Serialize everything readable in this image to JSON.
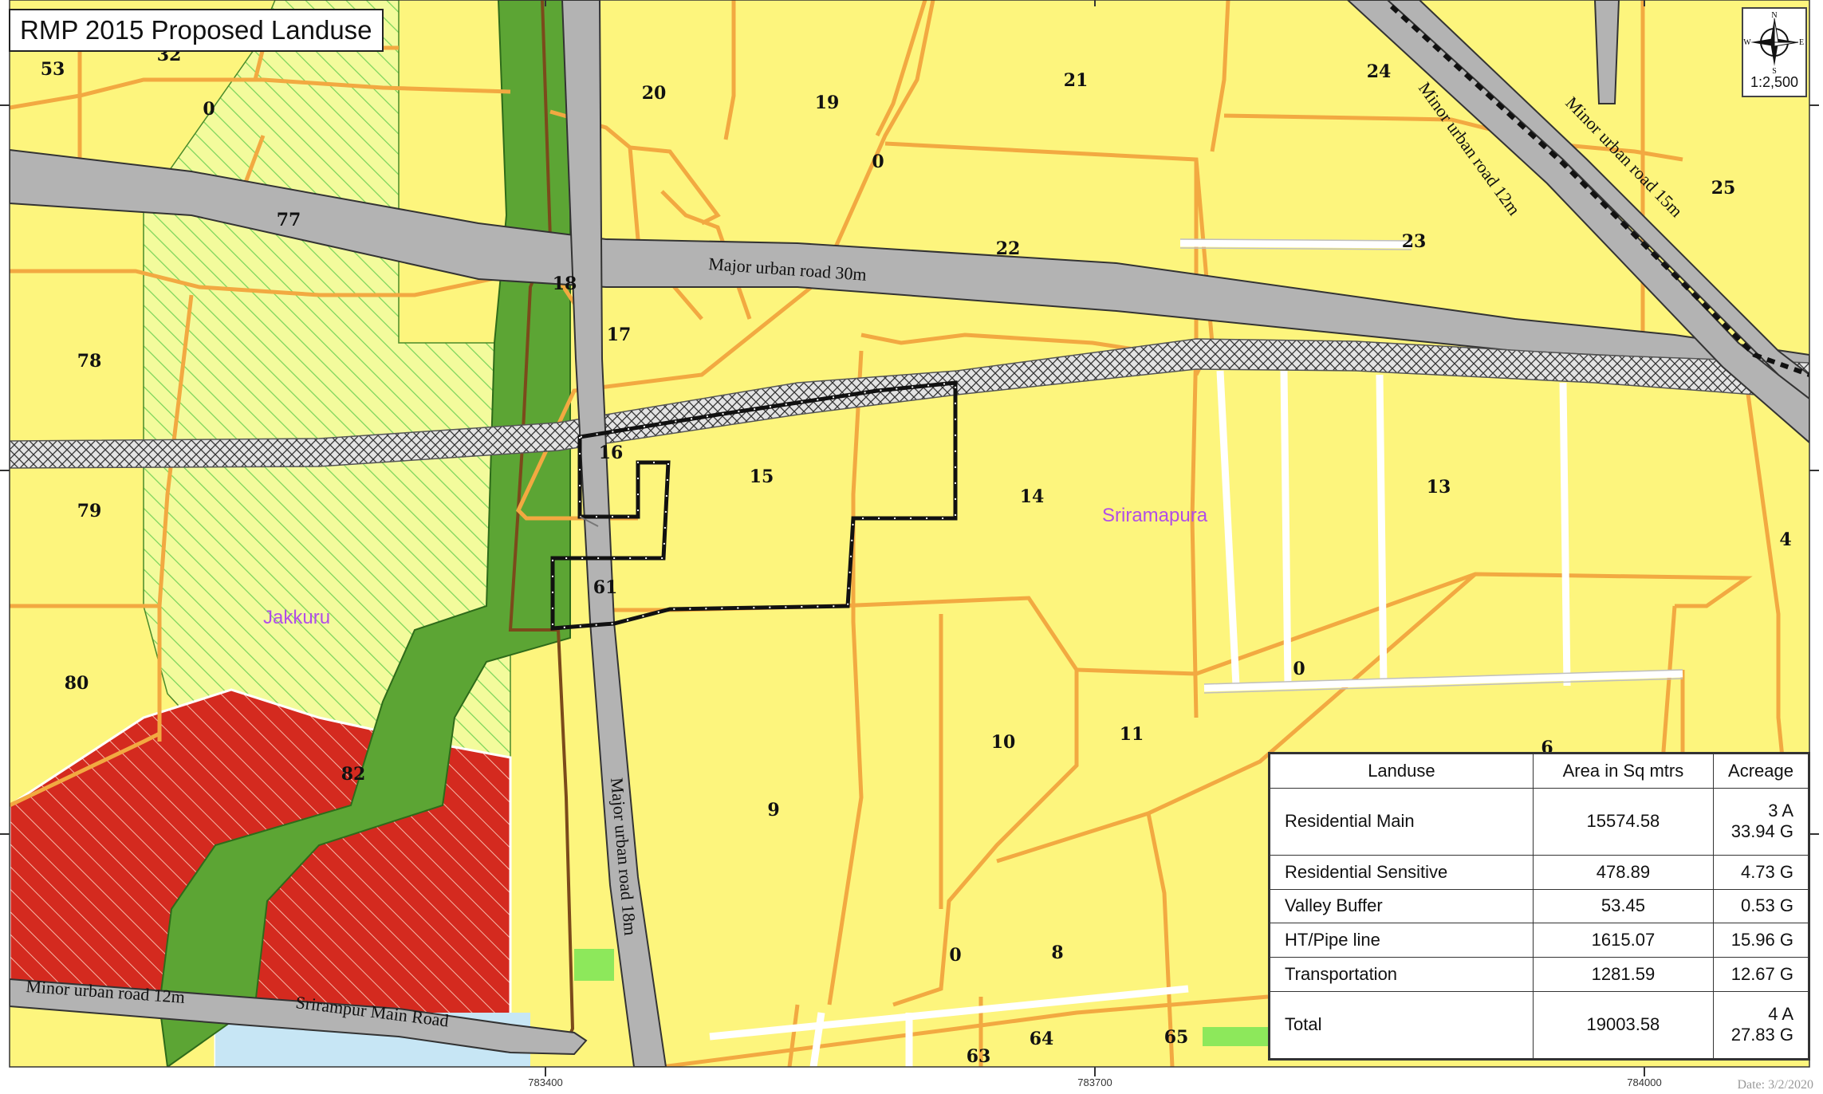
{
  "title": "RMP 2015 Proposed Landuse",
  "scale": "1:2,500",
  "compass": {
    "n": "N",
    "s": "S",
    "e": "E",
    "w": "W"
  },
  "date": "Date: 3/2/2020",
  "colors": {
    "residential": "#fdf57d",
    "road": "#b3b3b3",
    "plot_line": "#f2a941",
    "green": "#5ca534",
    "hatched_green_bg": "#f3fb9c",
    "hatched_green": "#7bd45b",
    "red_zone": "#d42a1f",
    "water": "#c7e6f5",
    "survey_boundary": "#111111",
    "village_label": "#b14ee8"
  },
  "roads": {
    "major_30": "Major urban road 30m",
    "minor_12_ne": "Minor urban road 12m",
    "minor_15_ne": "Minor urban road 15m",
    "major_18": "Major urban road 18m",
    "minor_12_sw": "Minor urban road 12m",
    "srirampur_main": "Srirampur Main Road"
  },
  "villages": {
    "jakkuru": "Jakkuru",
    "sriramapura": "Sriramapura"
  },
  "parcels": [
    {
      "id": "p53",
      "label": "53"
    },
    {
      "id": "p32",
      "label": "32"
    },
    {
      "id": "p0a",
      "label": "0"
    },
    {
      "id": "p20",
      "label": "20"
    },
    {
      "id": "p19",
      "label": "19"
    },
    {
      "id": "p21",
      "label": "21"
    },
    {
      "id": "p24",
      "label": "24"
    },
    {
      "id": "p25",
      "label": "25"
    },
    {
      "id": "p0b",
      "label": "0"
    },
    {
      "id": "p77",
      "label": "77"
    },
    {
      "id": "p22",
      "label": "22"
    },
    {
      "id": "p23",
      "label": "23"
    },
    {
      "id": "p18",
      "label": "18"
    },
    {
      "id": "p17",
      "label": "17"
    },
    {
      "id": "p78",
      "label": "78"
    },
    {
      "id": "p16",
      "label": "16"
    },
    {
      "id": "p15",
      "label": "15"
    },
    {
      "id": "p14",
      "label": "14"
    },
    {
      "id": "p13",
      "label": "13"
    },
    {
      "id": "p79",
      "label": "79"
    },
    {
      "id": "p4",
      "label": "4"
    },
    {
      "id": "p61",
      "label": "61"
    },
    {
      "id": "p80",
      "label": "80"
    },
    {
      "id": "p0c",
      "label": "0"
    },
    {
      "id": "p10",
      "label": "10"
    },
    {
      "id": "p11",
      "label": "11"
    },
    {
      "id": "p6",
      "label": "6"
    },
    {
      "id": "p82",
      "label": "82"
    },
    {
      "id": "p9",
      "label": "9"
    },
    {
      "id": "p0d",
      "label": "0"
    },
    {
      "id": "p8",
      "label": "8"
    },
    {
      "id": "p64",
      "label": "64"
    },
    {
      "id": "p65",
      "label": "65"
    },
    {
      "id": "p63",
      "label": "63"
    }
  ],
  "grid_ticks": {
    "x1": "783400",
    "x2": "783700",
    "x3": "784000"
  },
  "table": {
    "headers": [
      "Landuse",
      "Area in Sq mtrs",
      "Acreage"
    ],
    "rows": [
      {
        "landuse": "Residential Main",
        "area": "15574.58",
        "acreage": "3 A 33.94 G"
      },
      {
        "landuse": "Residential Sensitive",
        "area": "478.89",
        "acreage": "4.73 G"
      },
      {
        "landuse": "Valley Buffer",
        "area": "53.45",
        "acreage": "0.53 G"
      },
      {
        "landuse": "HT/Pipe line",
        "area": "1615.07",
        "acreage": "15.96 G"
      },
      {
        "landuse": "Transportation",
        "area": "1281.59",
        "acreage": "12.67 G"
      },
      {
        "landuse": "Total",
        "area": "19003.58",
        "acreage": "4 A 27.83 G"
      }
    ]
  }
}
